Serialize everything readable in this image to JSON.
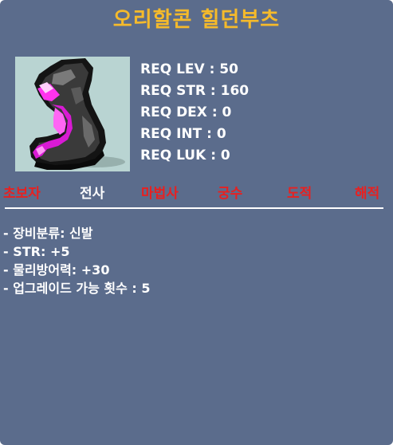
{
  "item": {
    "name": "오리할콘 힐던부츠",
    "icon": "boots-icon"
  },
  "requirements": [
    "REQ LEV : 50",
    "REQ STR : 160",
    "REQ DEX : 0",
    "REQ INT : 0",
    "REQ LUK : 0"
  ],
  "jobs": [
    {
      "label": "초보자",
      "active": false
    },
    {
      "label": "전사",
      "active": true
    },
    {
      "label": "마법사",
      "active": false
    },
    {
      "label": "궁수",
      "active": false
    },
    {
      "label": "도적",
      "active": false
    },
    {
      "label": "해적",
      "active": false
    }
  ],
  "stats": [
    "- 장비분류: 신발",
    "- STR: +5",
    "- 물리방어력: +30",
    "- 업그레이드 가능 횟수 : 5"
  ],
  "colors": {
    "title": "#f5ba2b",
    "background": "#5b6c8c",
    "job_unavailable": "#e82020",
    "job_available": "#ffffff",
    "icon_bg": "#b9d4d2"
  }
}
